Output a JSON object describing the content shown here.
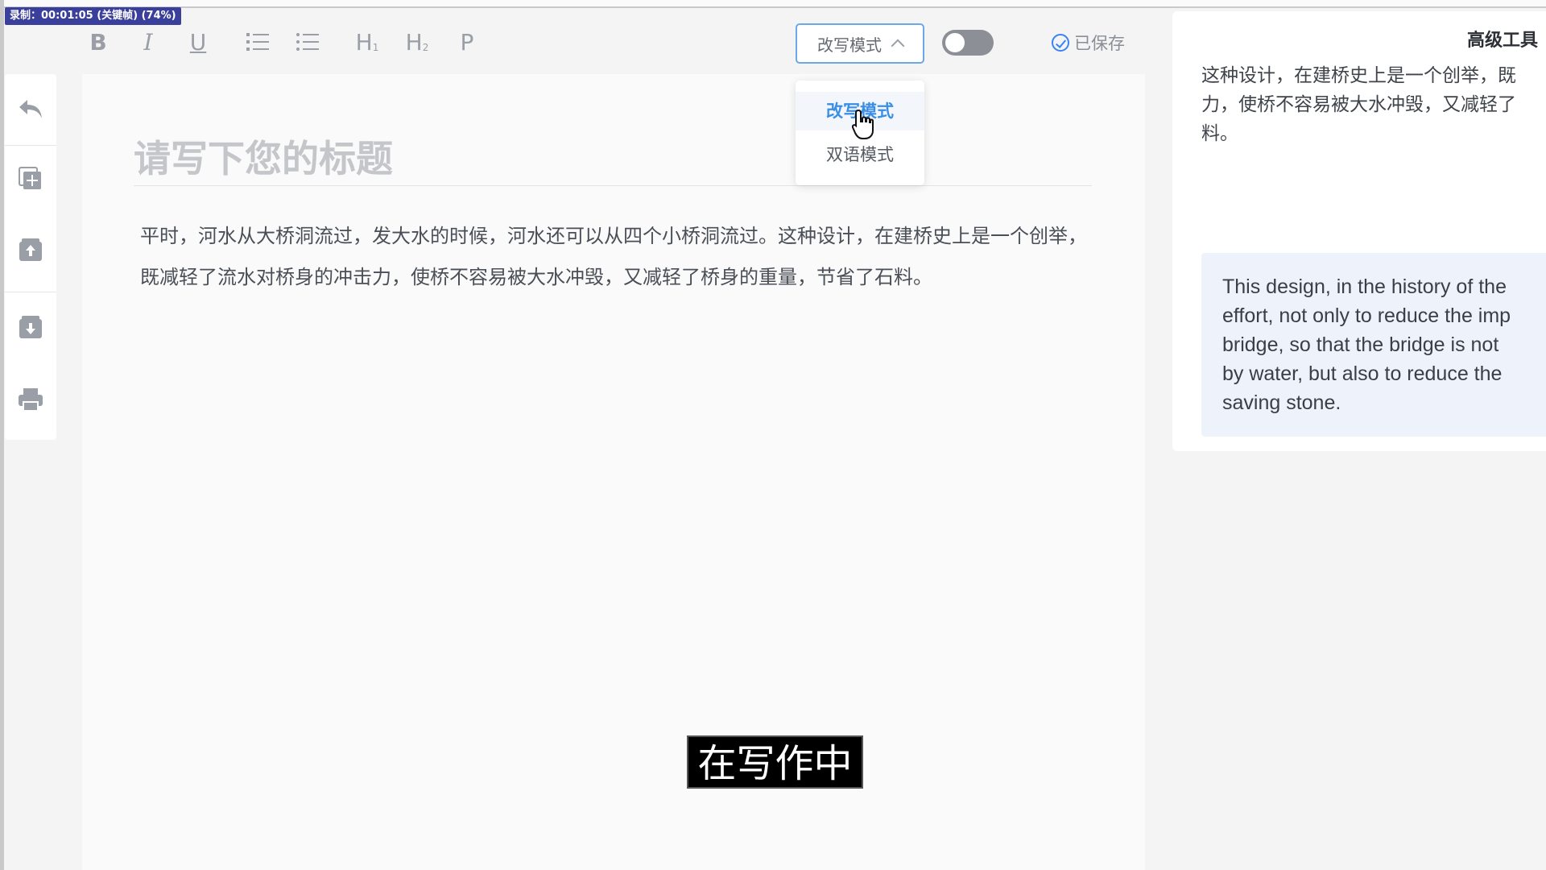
{
  "recording": {
    "badge": "录制：00:01:05 (关键帧) (74%)"
  },
  "toolbar": {
    "bold": "B",
    "italic": "I",
    "underline": "U",
    "heading1": "H",
    "heading1_sub": "1",
    "heading2": "H",
    "heading2_sub": "2",
    "paragraph": "P",
    "mode_select_value": "改写模式",
    "saved_label": "已保存"
  },
  "mode_dropdown": {
    "options": [
      "改写模式",
      "双语模式"
    ],
    "selected": "改写模式"
  },
  "editor": {
    "title_placeholder": "请写下您的标题",
    "body": "平时，河水从大桥洞流过，发大水的时候，河水还可以从四个小桥洞流过。这种设计，在建桥史上是一个创举，既减轻了流水对桥身的冲击力，使桥不容易被大水冲毁，又减轻了桥身的重量，节省了石料。"
  },
  "right_panel": {
    "header": "高级工具",
    "source_lines": [
      "这种设计，在建桥史上是一个创举，既",
      "力，使桥不容易被大水冲毁，又减轻了",
      "料。"
    ],
    "translation_lines": [
      "This design, in the history of the",
      "effort, not only to reduce the imp",
      "bridge, so that the bridge is not",
      "by water, but also to reduce the",
      "saving stone."
    ]
  },
  "status_overlay": "在写作中",
  "colors": {
    "accent": "#3a8ee6",
    "toggle_off": "#8c8f96",
    "translation_bg": "#eef3fb"
  },
  "icons": [
    "undo-icon",
    "duplicate-add-icon",
    "upload-box-icon",
    "download-box-icon",
    "printer-icon",
    "check-circle-icon",
    "chevron-up-icon",
    "hand-cursor-icon"
  ]
}
